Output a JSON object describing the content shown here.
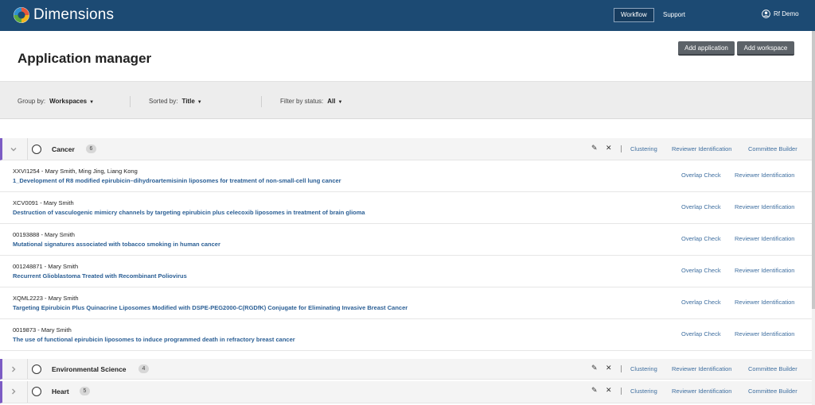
{
  "app": {
    "logo_text": "Dimensions",
    "nav": {
      "workflow": "Workflow",
      "support": "Support",
      "user": "Rf Demo"
    }
  },
  "header": {
    "title": "Application manager",
    "add_application": "Add application",
    "add_workspace": "Add workspace"
  },
  "filters": {
    "group_by": {
      "label": "Group by:",
      "value": "Workspaces"
    },
    "sorted_by": {
      "label": "Sorted by:",
      "value": "Title"
    },
    "status": {
      "label": "Filter by status:",
      "value": "All"
    }
  },
  "group_actions": {
    "clustering": "Clustering",
    "reviewer_identification": "Reviewer Identification",
    "committee_builder": "Committee Builder"
  },
  "row_actions": {
    "overlap_check": "Overlap Check",
    "reviewer_identification": "Reviewer Identification"
  },
  "groups": [
    {
      "name": "Cancer",
      "count": "6",
      "expanded": true,
      "applications": [
        {
          "meta": "XXVI1254 - Mary Smith, Ming Jing, Liang Kong",
          "title": "1_Development of R8 modified epirubicin–dihydroartemisinin liposomes for treatment of non-small-cell lung cancer"
        },
        {
          "meta": "XCV0091 - Mary Smith",
          "title": "Destruction of vasculogenic mimicry channels by targeting epirubicin plus celecoxib liposomes in treatment of brain glioma"
        },
        {
          "meta": "00193888 - Mary Smith",
          "title": "Mutational signatures associated with tobacco smoking in human cancer"
        },
        {
          "meta": "001248871 - Mary Smith",
          "title": "Recurrent Glioblastoma Treated with Recombinant Poliovirus"
        },
        {
          "meta": "XQML2223 - Mary Smith",
          "title": "Targeting Epirubicin Plus Quinacrine Liposomes Modified with DSPE-PEG2000-C(RGDfK) Conjugate for Eliminating Invasive Breast Cancer"
        },
        {
          "meta": "0019873 - Mary Smith",
          "title": "The use of functional epirubicin liposomes to induce programmed death in refractory breast cancer"
        }
      ]
    },
    {
      "name": "Environmental Science",
      "count": "4",
      "expanded": false
    },
    {
      "name": "Heart",
      "count": "5",
      "expanded": false
    }
  ],
  "colors": {
    "nav_bg": "#1c4a73",
    "link": "#3f6fa0",
    "title_link": "#2b5f95",
    "group_accent": "#7c5cc4"
  }
}
